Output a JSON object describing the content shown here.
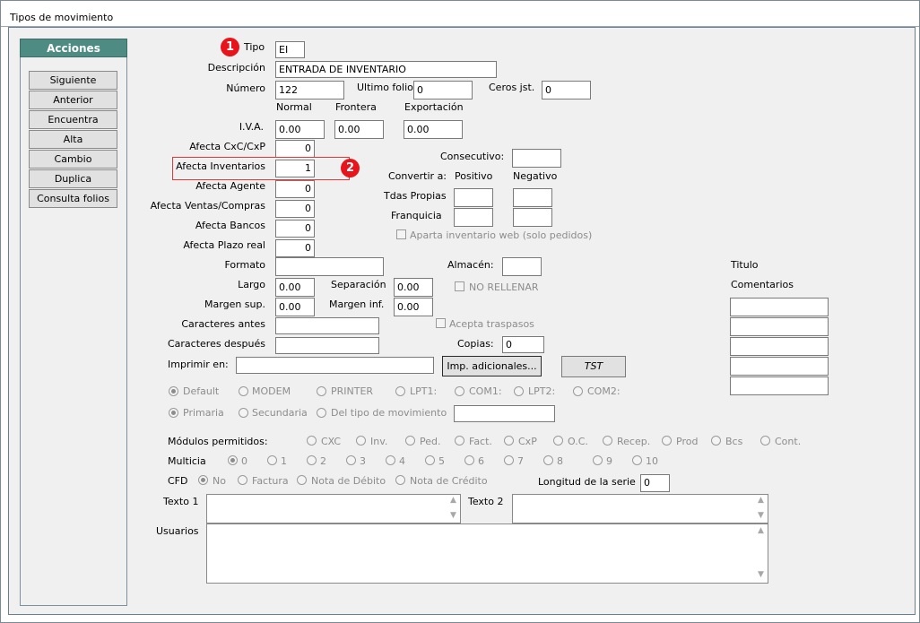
{
  "window": {
    "title": "Tipos de movimiento"
  },
  "acciones": {
    "header": "Acciones",
    "buttons": [
      "Siguiente",
      "Anterior",
      "Encuentra",
      "Alta",
      "Cambio",
      "Duplica",
      "Consulta folios"
    ]
  },
  "badges": {
    "one": "1",
    "two": "2"
  },
  "form": {
    "tipo_label": "Tipo",
    "tipo_value": "EI",
    "descripcion_label": "Descripción",
    "descripcion_value": "ENTRADA DE INVENTARIO",
    "numero_label": "Número",
    "numero_value": "122",
    "ultimo_folio_label": "Ultimo folio",
    "ultimo_folio_value": "0",
    "ceros_label": "Ceros jst.",
    "ceros_value": "0",
    "col_normal": "Normal",
    "col_frontera": "Frontera",
    "col_exportacion": "Exportación",
    "iva_label": "I.V.A.",
    "iva_normal": "0.00",
    "iva_frontera": "0.00",
    "iva_exportacion": "0.00",
    "afecta_cxc_label": "Afecta  CxC/CxP",
    "afecta_cxc_value": "0",
    "afecta_inv_label": "Afecta  Inventarios",
    "afecta_inv_value": "1",
    "afecta_agente_label": "Afecta  Agente",
    "afecta_agente_value": "0",
    "afecta_vc_label": "Afecta  Ventas/Compras",
    "afecta_vc_value": "0",
    "afecta_bancos_label": "Afecta  Bancos",
    "afecta_bancos_value": "0",
    "afecta_plazo_label": "Afecta  Plazo real",
    "afecta_plazo_value": "0",
    "consecutivo_label": "Consecutivo:",
    "consecutivo_value": "",
    "convertir_label": "Convertir a:",
    "positivo_label": "Positivo",
    "negativo_label": "Negativo",
    "tdas_label": "Tdas Propias",
    "franquicia_label": "Franquicia",
    "aparta_label": "Aparta inventario web (solo pedidos)",
    "formato_label": "Formato",
    "formato_value": "",
    "almacen_label": "Almacén:",
    "almacen_value": "",
    "titulo_label": "Titulo",
    "comentarios_label": "Comentarios",
    "largo_label": "Largo",
    "largo_value": "0.00",
    "separacion_label": "Separación",
    "separacion_value": "0.00",
    "no_rellenar_label": "NO RELLENAR",
    "margen_sup_label": "Margen sup.",
    "margen_sup_value": "0.00",
    "margen_inf_label": "Margen inf.",
    "margen_inf_value": "0.00",
    "car_antes_label": "Caracteres antes",
    "car_despues_label": "Caracteres después",
    "acepta_label": "Acepta traspasos",
    "copias_label": "Copias:",
    "copias_value": "0",
    "imprimir_label": "Imprimir en:",
    "imprimir_value": "",
    "imp_adicionales_label": "Imp. adicionales...",
    "tst_label": "TST",
    "print_opts": [
      "Default",
      "MODEM",
      "PRINTER",
      "LPT1:",
      "COM1:",
      "LPT2:",
      "COM2:"
    ],
    "target_opts": [
      "Primaria",
      "Secundaria",
      "Del tipo de movimiento"
    ],
    "modulos_label": "Módulos permitidos:",
    "modulos": [
      "CXC",
      "Inv.",
      "Ped.",
      "Fact.",
      "CxP",
      "O.C.",
      "Recep.",
      "Prod",
      "Bcs",
      "Cont."
    ],
    "multicia_label": "Multicia",
    "multicia": [
      "0",
      "1",
      "2",
      "3",
      "4",
      "5",
      "6",
      "7",
      "8",
      "9",
      "10"
    ],
    "cfd_label": "CFD",
    "cfd_opts": [
      "No",
      "Factura",
      "Nota de Débito",
      "Nota de Crédito"
    ],
    "longitud_label": "Longitud de la serie",
    "longitud_value": "0",
    "texto1_label": "Texto 1",
    "texto2_label": "Texto 2",
    "usuarios_label": "Usuarios"
  },
  "colors": {
    "header_teal": "#4e8c83",
    "badge_red": "#e8141b",
    "highlight_red": "#e23a3a"
  }
}
